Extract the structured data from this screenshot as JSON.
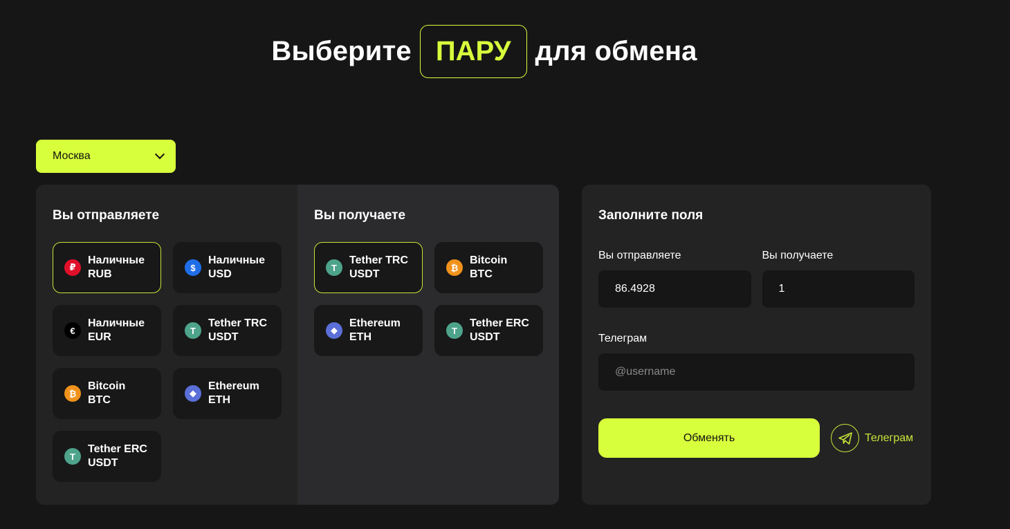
{
  "hero": {
    "before": "Выберите",
    "highlight": "ПАРУ",
    "after": "для обмена"
  },
  "city": {
    "selected": "Москва"
  },
  "send": {
    "title": "Вы отправляете",
    "items": [
      {
        "label": "Наличные\nRUB",
        "icon": "ruble-icon",
        "symbol": "₽",
        "color": "#e0102b",
        "active": true
      },
      {
        "label": "Наличные\nUSD",
        "icon": "dollar-icon",
        "symbol": "$",
        "color": "#1f6ee8",
        "active": false
      },
      {
        "label": "Наличные\nEUR",
        "icon": "euro-icon",
        "symbol": "€",
        "color": "#000000",
        "active": false
      },
      {
        "label": "Tether TRC\nUSDT",
        "icon": "tether-icon",
        "symbol": "T",
        "color": "#4ea48a",
        "active": false
      },
      {
        "label": "Bitcoin BTC",
        "icon": "bitcoin-icon",
        "symbol": "₿",
        "color": "#f0921b",
        "active": false
      },
      {
        "label": "Ethereum\nETH",
        "icon": "ethereum-icon",
        "symbol": "◆",
        "color": "#5b6fd8",
        "active": false
      },
      {
        "label": "Tether ERC\nUSDT",
        "icon": "tether-icon",
        "symbol": "T",
        "color": "#4ea48a",
        "active": false
      }
    ]
  },
  "receive": {
    "title": "Вы получаете",
    "items": [
      {
        "label": "Tether TRC\nUSDT",
        "icon": "tether-icon",
        "symbol": "T",
        "color": "#4ea48a",
        "active": true
      },
      {
        "label": "Bitcoin BTC",
        "icon": "bitcoin-icon",
        "symbol": "₿",
        "color": "#f0921b",
        "active": false
      },
      {
        "label": "Ethereum\nETH",
        "icon": "ethereum-icon",
        "symbol": "◆",
        "color": "#5b6fd8",
        "active": false
      },
      {
        "label": "Tether ERC\nUSDT",
        "icon": "tether-icon",
        "symbol": "T",
        "color": "#4ea48a",
        "active": false
      }
    ]
  },
  "form": {
    "title": "Заполните поля",
    "send_label": "Вы отправляете",
    "send_value": "86.4928",
    "receive_label": "Вы получаете",
    "receive_value": "1",
    "telegram_label": "Телеграм",
    "telegram_placeholder": "@username",
    "submit_label": "Обменять",
    "telegram_link": "Телеграм"
  },
  "colors": {
    "accent": "#d8ff3c",
    "background": "#161616",
    "panel": "#232323"
  }
}
